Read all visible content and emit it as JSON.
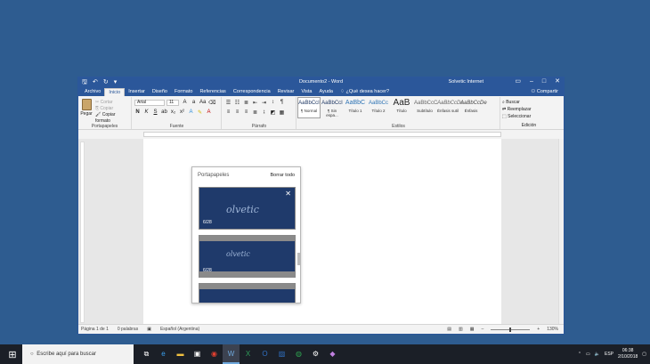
{
  "window": {
    "title": "Documento2 - Word",
    "user": "Solvetic Internet",
    "share": "Compartir",
    "tell_me": "¿Qué desea hacer?"
  },
  "tabs": [
    "Archivo",
    "Inicio",
    "Insertar",
    "Diseño",
    "Formato",
    "Referencias",
    "Correspondencia",
    "Revisar",
    "Vista",
    "Ayuda"
  ],
  "ribbon": {
    "clipboard": {
      "paste": "Pegar",
      "cut": "Cortar",
      "copy": "Copiar",
      "format_painter": "Copiar formato",
      "label": "Portapapeles"
    },
    "font": {
      "name": "Arial",
      "size": "11",
      "label": "Fuente"
    },
    "paragraph": {
      "label": "Párrafo"
    },
    "styles": {
      "label": "Estilos",
      "items": [
        {
          "preview": "AaBbCcI",
          "name": "¶ Normal"
        },
        {
          "preview": "AaBbCcI",
          "name": "¶ Sin espa..."
        },
        {
          "preview": "AaBbC",
          "name": "Título 1"
        },
        {
          "preview": "AaBbCc",
          "name": "Título 2"
        },
        {
          "preview": "AaB",
          "name": "Título"
        },
        {
          "preview": "AaBbCcC",
          "name": "Subtítulo"
        },
        {
          "preview": "AaBbCcDe",
          "name": "Énfasis sutil"
        },
        {
          "preview": "AaBbCcDe",
          "name": "Énfasis"
        }
      ]
    },
    "editing": {
      "find": "Buscar",
      "replace": "Reemplazar",
      "select": "Seleccionar",
      "label": "Edición"
    }
  },
  "clipboard_panel": {
    "title": "Portapapeles",
    "clear_all": "Borrar todo",
    "item1_size": "6/28",
    "item2_size": "6/28",
    "logo": "olvetic"
  },
  "status": {
    "page": "Página 1 de 1",
    "words": "0 palabras",
    "language": "Español (Argentina)",
    "zoom": "130%"
  },
  "taskbar": {
    "search_placeholder": "Escribe aquí para buscar",
    "lang": "ESP",
    "time": "06:38",
    "date": "2/10/2018"
  },
  "colors": {
    "word_blue": "#2b579a",
    "desktop": "#2e5c90",
    "taskbar": "#1b1f27"
  }
}
